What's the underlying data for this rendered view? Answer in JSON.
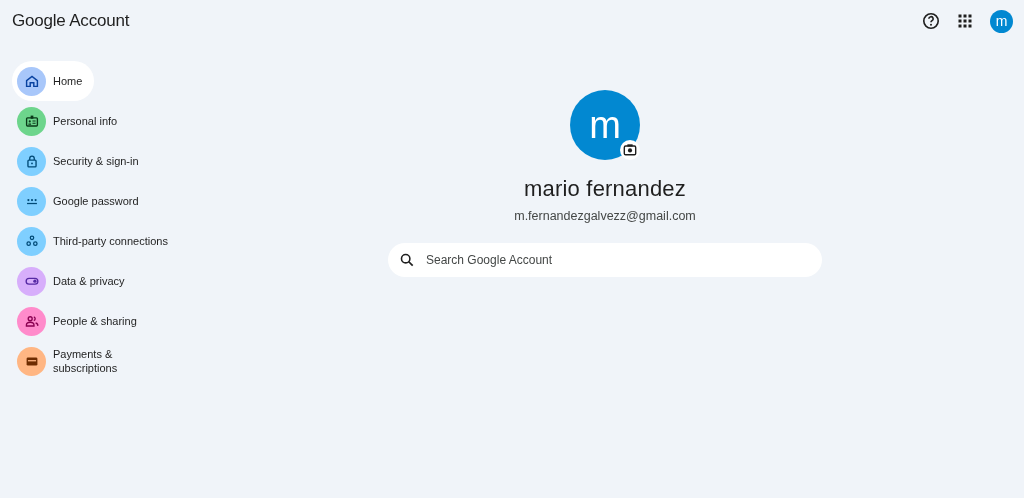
{
  "header": {
    "title": "Google Account",
    "avatar_letter": "m"
  },
  "sidebar": {
    "items": [
      {
        "label": "Home",
        "selected": true,
        "color": "#a8c7fa"
      },
      {
        "label": "Personal info",
        "selected": false,
        "color": "#6dd58c"
      },
      {
        "label": "Security & sign-in",
        "selected": false,
        "color": "#7fcfff"
      },
      {
        "label": "Google password",
        "selected": false,
        "color": "#7fcfff"
      },
      {
        "label": "Third-party connections",
        "selected": false,
        "color": "#7fcfff"
      },
      {
        "label": "Data & privacy",
        "selected": false,
        "color": "#d7aefb"
      },
      {
        "label": "People & sharing",
        "selected": false,
        "color": "#ff8bcb"
      },
      {
        "label": "Payments & subscriptions",
        "selected": false,
        "color": "#ffb683"
      }
    ]
  },
  "profile": {
    "avatar_letter": "m",
    "name": "mario fernandez",
    "email": "m.fernandezgalvezz@gmail.com"
  },
  "search": {
    "placeholder": "Search Google Account"
  }
}
